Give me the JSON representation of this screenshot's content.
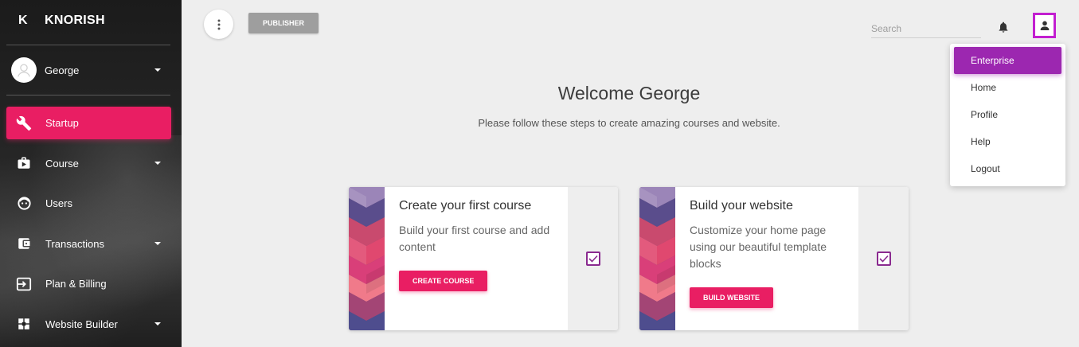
{
  "brand": {
    "letter": "K",
    "name": "KNORISH"
  },
  "user": {
    "name": "George"
  },
  "sidebar": {
    "items": [
      {
        "label": "Startup",
        "icon": "wrench-icon",
        "active": true,
        "has_caret": false
      },
      {
        "label": "Course",
        "icon": "course-icon",
        "active": false,
        "has_caret": true
      },
      {
        "label": "Users",
        "icon": "users-icon",
        "active": false,
        "has_caret": false
      },
      {
        "label": "Transactions",
        "icon": "wallet-icon",
        "active": false,
        "has_caret": true
      },
      {
        "label": "Plan & Billing",
        "icon": "billing-icon",
        "active": false,
        "has_caret": false
      },
      {
        "label": "Website Builder",
        "icon": "website-builder-icon",
        "active": false,
        "has_caret": true
      }
    ]
  },
  "topbar": {
    "publisher_label": "PUBLISHER",
    "search_placeholder": "Search"
  },
  "dropdown": {
    "items": [
      {
        "label": "Enterprise",
        "active": true
      },
      {
        "label": "Home",
        "active": false
      },
      {
        "label": "Profile",
        "active": false
      },
      {
        "label": "Help",
        "active": false
      },
      {
        "label": "Logout",
        "active": false
      }
    ]
  },
  "main": {
    "welcome": "Welcome George",
    "subtitle": "Please follow these steps to create amazing courses and website."
  },
  "cards": [
    {
      "title": "Create your first course",
      "description": "Build your first course and add content",
      "button": "CREATE COURSE",
      "checked": true
    },
    {
      "title": "Build your website",
      "description": "Customize your home page using our beautiful template blocks",
      "button": "BUILD WEBSITE",
      "checked": true
    }
  ],
  "colors": {
    "accent": "#e91e63",
    "dropdown_active": "#9c27b0",
    "profile_highlight": "#c21fd0",
    "publisher": "#9e9e9e"
  }
}
